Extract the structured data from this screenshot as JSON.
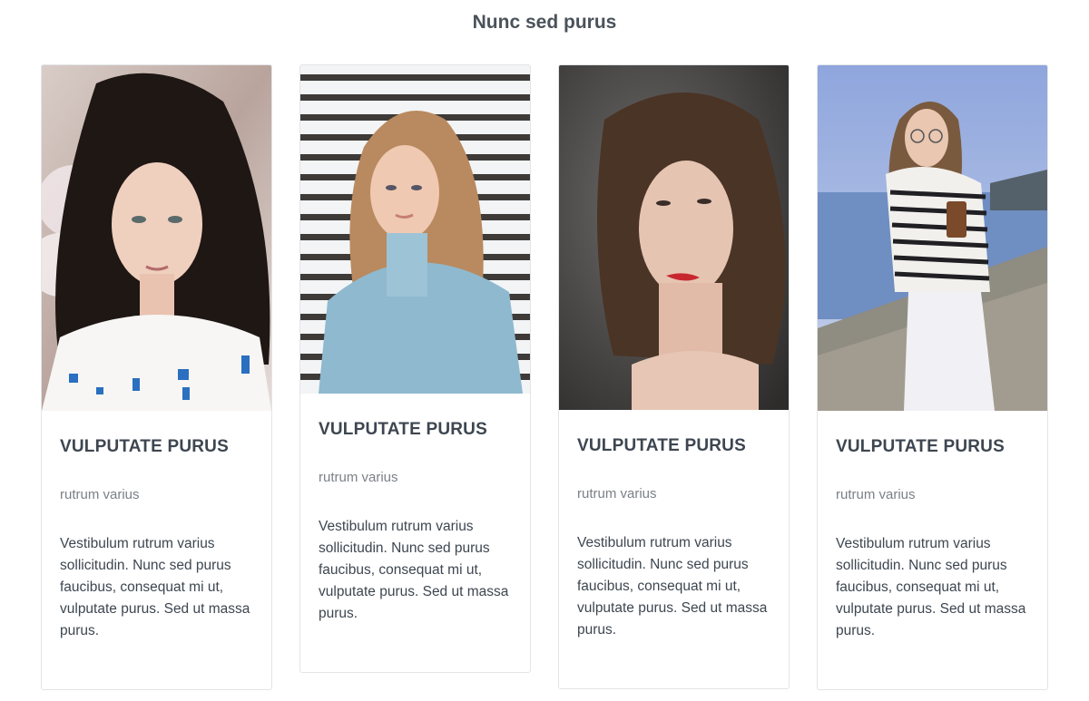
{
  "page": {
    "title": "Nunc sed purus"
  },
  "cards": [
    {
      "image": "portrait-woman-dark-hair-blossoms",
      "heading": "VULPUTATE PURUS",
      "subheading": "rutrum varius",
      "text": "Vestibulum rutrum varius sollicitudin. Nunc sed purus faucibus, consequat mi ut, vulputate purus. Sed ut massa purus."
    },
    {
      "image": "portrait-woman-blue-turtleneck-blinds",
      "heading": "VULPUTATE PURUS",
      "subheading": "rutrum varius",
      "text": "Vestibulum rutrum varius sollicitudin. Nunc sed purus faucibus, consequat mi ut, vulputate purus. Sed ut massa purus."
    },
    {
      "image": "portrait-woman-curly-hair-red-lips",
      "heading": "VULPUTATE PURUS",
      "subheading": "rutrum varius",
      "text": "Vestibulum rutrum varius sollicitudin. Nunc sed purus faucibus, consequat mi ut, vulputate purus. Sed ut massa purus."
    },
    {
      "image": "portrait-woman-striped-sweater-seaside",
      "heading": "VULPUTATE PURUS",
      "subheading": "rutrum varius",
      "text": "Vestibulum rutrum varius sollicitudin. Nunc sed purus faucibus, consequat mi ut, vulputate purus. Sed ut massa purus."
    }
  ]
}
